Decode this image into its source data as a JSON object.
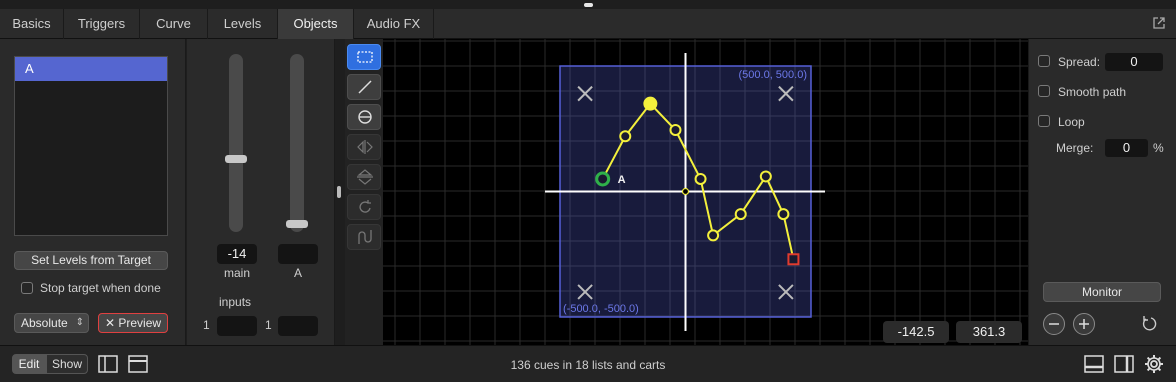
{
  "tabs": [
    "Basics",
    "Triggers",
    "Curve",
    "Levels",
    "Objects",
    "Audio FX"
  ],
  "left": {
    "targets": [
      "A"
    ],
    "set_levels_label": "Set Levels from Target",
    "stop_target_label": "Stop target when done",
    "mode_value": "Absolute",
    "preview_label": "Preview",
    "preview_x": "✕"
  },
  "faders": {
    "main_value": "-14",
    "main_label": "main",
    "a_value": "",
    "a_label": "A",
    "main_level": 0.4,
    "a_level": 0.0,
    "inputs_label": "inputs",
    "input1_num": "1",
    "input2_num": "1"
  },
  "tools": [
    "marquee-select",
    "line",
    "circle",
    "flip-horizontal",
    "flip-vertical",
    "rotate",
    "smooth"
  ],
  "plot": {
    "top_right_label": "(500.0, 500.0)",
    "bottom_left_label": "(-500.0, -500.0)",
    "object_label": "A",
    "x_value": "-142.5",
    "y_value": "361.3",
    "help": "?",
    "path_points": [
      [
        -330,
        50
      ],
      [
        -240,
        220
      ],
      [
        -140,
        350
      ],
      [
        -40,
        245
      ],
      [
        60,
        50
      ],
      [
        110,
        -175
      ],
      [
        220,
        -90
      ],
      [
        320,
        60
      ],
      [
        390,
        -90
      ],
      [
        430,
        -270
      ]
    ],
    "start_point": [
      -330,
      50
    ],
    "end_point": [
      430,
      -270
    ],
    "highlight_point": [
      -140,
      350
    ],
    "corner_markers": [
      [
        -400,
        390
      ],
      [
        400,
        390
      ],
      [
        -400,
        -400
      ],
      [
        400,
        -400
      ]
    ],
    "colors": {
      "path": "#f3f03c",
      "box": "#5560d8",
      "start": "#2fb04a",
      "end": "#e03b2e"
    }
  },
  "right": {
    "spread_label": "Spread:",
    "spread_value": "0",
    "smooth_label": "Smooth path",
    "loop_label": "Loop",
    "merge_label": "Merge:",
    "merge_value": "0",
    "merge_unit": "%",
    "monitor_label": "Monitor"
  },
  "bottom": {
    "edit_label": "Edit",
    "show_label": "Show",
    "status": "136 cues in 18 lists and carts"
  }
}
